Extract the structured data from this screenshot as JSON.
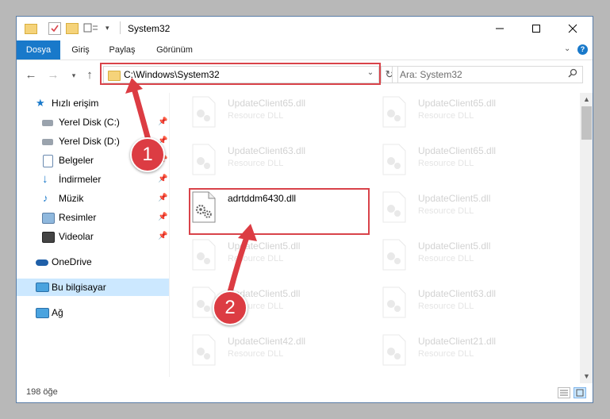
{
  "window": {
    "title": "System32",
    "minimize_icon": "minimize-icon",
    "maximize_icon": "maximize-icon",
    "close_icon": "close-icon"
  },
  "ribbon": {
    "tabs": [
      {
        "label": "Dosya",
        "active": true
      },
      {
        "label": "Giriş",
        "active": false
      },
      {
        "label": "Paylaş",
        "active": false
      },
      {
        "label": "Görünüm",
        "active": false
      }
    ],
    "expand_icon": "chevron-down-icon",
    "help_icon": "help-icon"
  },
  "nav": {
    "address": "C:\\Windows\\System32",
    "search_placeholder": "Ara: System32"
  },
  "sidebar": {
    "items": [
      {
        "label": "Hızlı erişim",
        "icon": "star-icon"
      },
      {
        "label": "Yerel Disk (C:)",
        "icon": "drive-icon"
      },
      {
        "label": "Yerel Disk (D:)",
        "icon": "drive-icon"
      },
      {
        "label": "Belgeler",
        "icon": "documents-icon"
      },
      {
        "label": "İndirmeler",
        "icon": "download-icon"
      },
      {
        "label": "Müzik",
        "icon": "music-icon"
      },
      {
        "label": "Resimler",
        "icon": "pictures-icon"
      },
      {
        "label": "Videolar",
        "icon": "videos-icon"
      },
      {
        "label": "OneDrive",
        "icon": "cloud-icon"
      },
      {
        "label": "Bu bilgisayar",
        "icon": "computer-icon",
        "selected": true
      },
      {
        "label": "Ağ",
        "icon": "network-icon"
      }
    ]
  },
  "files": {
    "left": [
      {
        "name": "UpdateClient65.dll",
        "type": "Resource DLL"
      },
      {
        "name": "UpdateClient63.dll",
        "type": "Resource DLL"
      },
      {
        "name": "adrtddm6430.dll",
        "type": ""
      },
      {
        "name": "UpdateClient5.dll",
        "type": "Resource DLL"
      },
      {
        "name": "UpdateClient5.dll",
        "type": "Resource DLL"
      },
      {
        "name": "UpdateClient42.dll",
        "type": "Resource DLL"
      }
    ],
    "right": [
      {
        "name": "UpdateClient65.dll",
        "type": "Resource DLL"
      },
      {
        "name": "UpdateClient65.dll",
        "type": "Resource DLL"
      },
      {
        "name": "UpdateClient5.dll",
        "type": "Resource DLL"
      },
      {
        "name": "UpdateClient5.dll",
        "type": "Resource DLL"
      },
      {
        "name": "UpdateClient63.dll",
        "type": "Resource DLL"
      },
      {
        "name": "UpdateClient21.dll",
        "type": "Resource DLL"
      }
    ]
  },
  "status": {
    "count": "198 öğe"
  },
  "annotations": {
    "callout_1": "1",
    "callout_2": "2",
    "highlight_color": "#d9434a"
  }
}
